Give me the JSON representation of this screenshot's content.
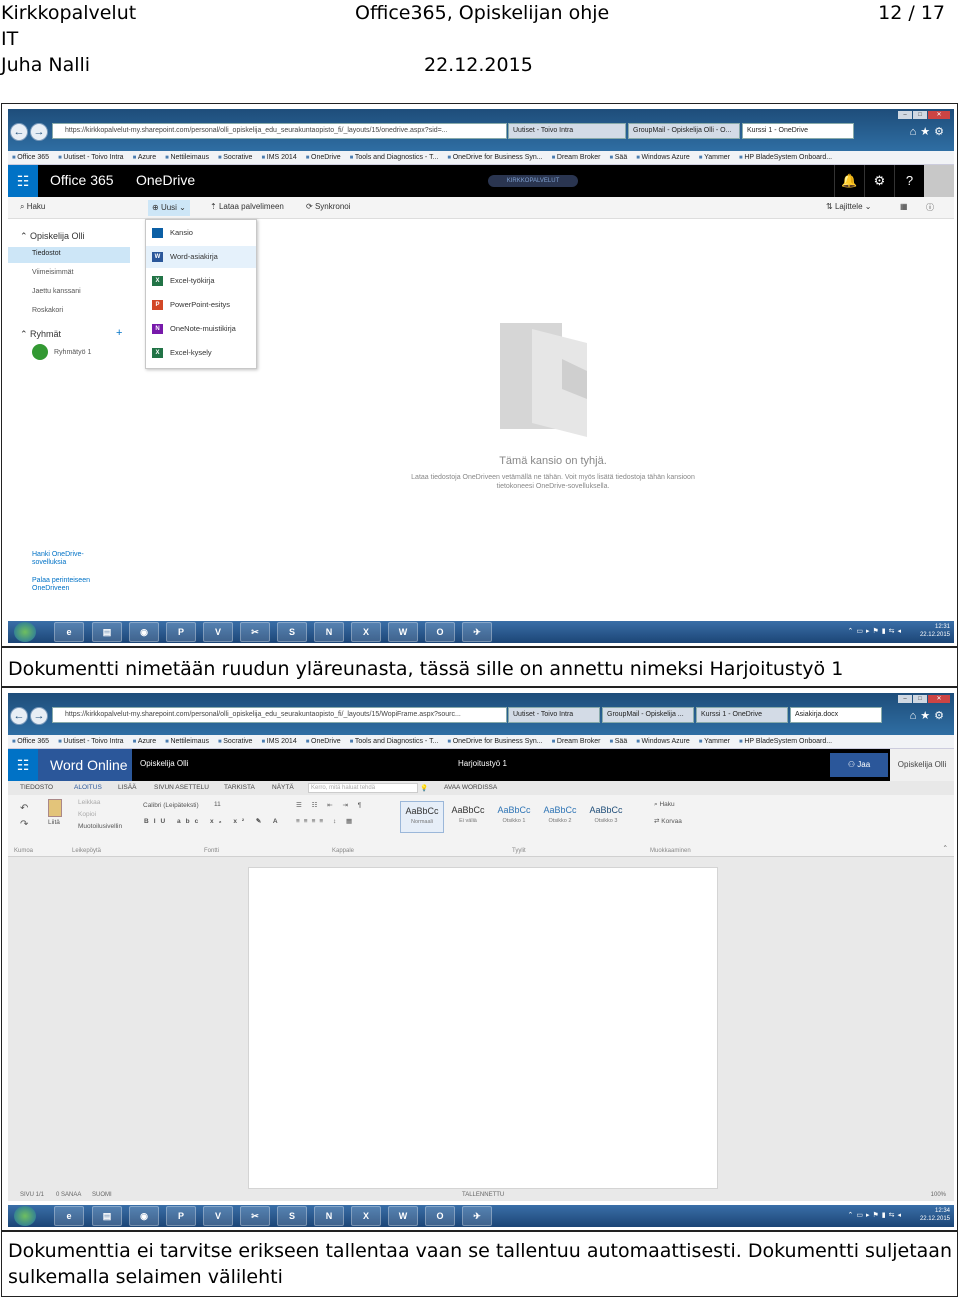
{
  "header": {
    "org_line1": "Kirkkopalvelut",
    "org_line2": "IT",
    "author": "Juha Nalli",
    "doc_title": "Office365, Opiskelijan ohje",
    "page": "12 / 17",
    "date": "22.12.2015"
  },
  "screenshot1": {
    "browser": {
      "address": "https://kirkkopalvelut-my.sharepoint.com/personal/olli_opiskelija_edu_seurakuntaopisto_fi/_layouts/15/onedrive.aspx?sid=...",
      "tabs": [
        "Uutiset - Toivo Intra",
        "GroupMail - Opiskelija Olli - O...",
        "Kurssi 1 - OneDrive"
      ],
      "favorites": [
        "Office 365",
        "Uutiset - Toivo Intra",
        "Azure",
        "Nettileimaus",
        "Socrative",
        "IMS 2014",
        "OneDrive",
        "Tools and Diagnostics - T...",
        "OneDrive for Business Syn...",
        "Dream Broker",
        "Sää",
        "Windows Azure",
        "Yammer",
        "HP BladeSystem Onboard..."
      ]
    },
    "suite": {
      "waffle": "☷",
      "office": "Office 365",
      "app": "OneDrive",
      "logo": "KIRKKOPALVELUT",
      "bell": "🔔",
      "gear": "⚙",
      "help": "?"
    },
    "commands": {
      "search": "Haku",
      "new": "Uusi",
      "upload": "Lataa palvelimeen",
      "sync": "Synkronoi",
      "sort": "Lajittele"
    },
    "leftnav": {
      "user": "Opiskelija Olli",
      "items": [
        "Tiedostot",
        "Viimeisimmät",
        "Jaettu kanssani",
        "Roskakori"
      ],
      "groups_label": "Ryhmät",
      "group_item": "Ryhmätyö 1",
      "footer1": "Hanki OneDrive-sovelluksia",
      "footer2": "Palaa perinteiseen OneDriveen"
    },
    "new_menu": [
      "Kansio",
      "Word-asiakirja",
      "Excel-työkirja",
      "PowerPoint-esitys",
      "OneNote-muistikirja",
      "Excel-kysely"
    ],
    "empty": {
      "title": "Tämä kansio on tyhjä.",
      "text": "Lataa tiedostoja OneDriveen vetämällä ne tähän. Voit myös lisätä tiedostoja tähän kansioon tietokoneesi OneDrive-sovelluksella."
    },
    "taskbar": {
      "time": "12:31",
      "date": "22.12.2015",
      "apps": [
        "e",
        "▤",
        "◉",
        "P",
        "V",
        "✂",
        "S",
        "N",
        "X",
        "W",
        "O",
        "✈"
      ]
    }
  },
  "caption1": "Dokumentti nimetään ruudun yläreunasta, tässä sille on annettu nimeksi Harjoitustyö 1",
  "screenshot2": {
    "browser": {
      "address": "https://kirkkopalvelut-my.sharepoint.com/personal/olli_opiskelija_edu_seurakuntaopisto_fi/_layouts/15/WopiFrame.aspx?sourc...",
      "tabs": [
        "Uutiset - Toivo Intra",
        "GroupMail - Opiskelija ...",
        "Kurssi 1 - OneDrive",
        "Asiakirja.docx"
      ]
    },
    "suite": {
      "app": "Word Online",
      "user_label": "Opiskelija Olli",
      "doc_name": "Harjoitustyö 1",
      "share": "Jaa",
      "user": "Opiskelija Olli"
    },
    "ribbon_tabs": [
      "TIEDOSTO",
      "ALOITUS",
      "LISÄÄ",
      "SIVUN ASETTELU",
      "TARKISTA",
      "NÄYTÄ"
    ],
    "tell_me": "Kerro, mitä haluat tehdä",
    "open_in_word": "AVAA WORDISSA",
    "clipboard": {
      "paste": "Liitä",
      "cut": "Leikkaa",
      "copy": "Kopioi",
      "format": "Muotoilusivellin"
    },
    "font_name": "Calibri (Leipäteksti)",
    "font_size": "11",
    "styles": [
      {
        "sample": "AaBbCc",
        "name": "Normaali"
      },
      {
        "sample": "AaBbCc",
        "name": "Ei väliä"
      },
      {
        "sample": "AaBbCc",
        "name": "Otsikko 1"
      },
      {
        "sample": "AaBbCc",
        "name": "Otsikko 2"
      },
      {
        "sample": "AaBbCc",
        "name": "Otsikko 3"
      }
    ],
    "editing": {
      "find": "Haku",
      "replace": "Korvaa"
    },
    "groups": [
      "Kumoa",
      "Leikepöytä",
      "Fontti",
      "Kappale",
      "Tyylit",
      "Muokkaaminen"
    ],
    "status": {
      "page": "SIVU 1/1",
      "words": "0 SANAA",
      "lang": "SUOMI",
      "saved": "TALLENNETTU",
      "zoom": "100%"
    },
    "taskbar": {
      "time": "12:34",
      "date": "22.12.2015"
    }
  },
  "caption2_line1": "Dokumenttia ei tarvitse erikseen tallentaa vaan se tallentuu automaattisesti. Dokumentti suljetaan",
  "caption2_line2": "sulkemalla selaimen välilehti"
}
